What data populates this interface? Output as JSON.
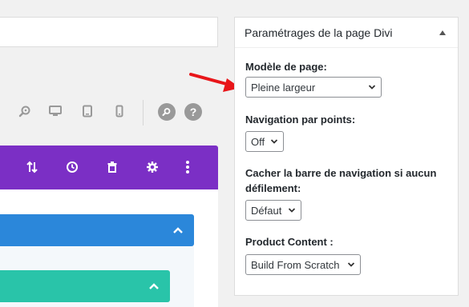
{
  "colors": {
    "builder_purple": "#7b2fc5",
    "row_blue": "#2b87da",
    "row_teal": "#29c4a9",
    "annotation_red": "#e8161a",
    "icon_gray": "#999999"
  },
  "toolbar": {
    "icons": [
      "zoom-icon",
      "desktop-icon",
      "tablet-icon",
      "phone-icon",
      "search-icon",
      "help-icon"
    ],
    "help_label": "?"
  },
  "builder": {
    "bar_icons": [
      "sort-icon",
      "history-icon",
      "trash-icon",
      "gear-icon",
      "more-icon"
    ]
  },
  "panel": {
    "title": "Paramétrages de la page Divi",
    "fields": [
      {
        "label": "Modèle de page:",
        "value": "Pleine largeur"
      },
      {
        "label": "Navigation par points:",
        "value": "Off"
      },
      {
        "label": "Cacher la barre de navigation si aucun défilement:",
        "value": "Défaut"
      },
      {
        "label": "Product Content :",
        "value": "Build From Scratch"
      }
    ]
  }
}
